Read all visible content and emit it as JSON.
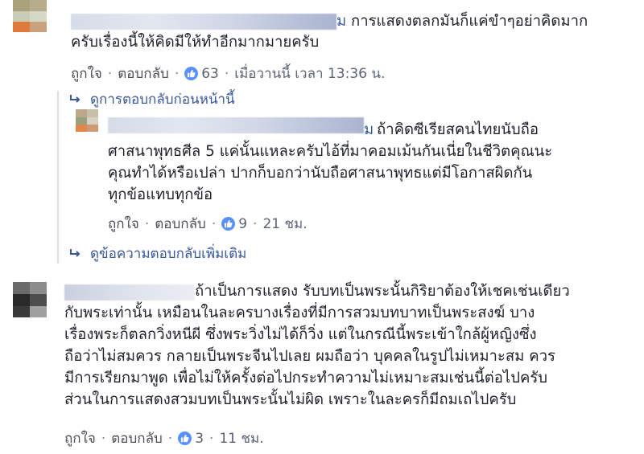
{
  "actions": {
    "like": "ถูกใจ",
    "reply": "ตอบกลับ",
    "dot": "·"
  },
  "comments": [
    {
      "name_visible": "ม",
      "lines": [
        "การแสดงตลกมันก็แค่ขำๆอย่าคิดมาก",
        "ครับเรื่องนี้ให้คิดมีให้ทำอีกมากมายครับ"
      ],
      "reactions": "63",
      "time": "เมื่อวานนี้ เวลา 13:36 น."
    },
    {
      "name_visible": "ม",
      "lines": [
        "ถ้าคิดซีเรียสคนไทยนับถือ",
        "ศาสนาพุทธศีล 5 แค่นั้นแหละครับไอ้ที่มาคอมเม้นกันเนี่ยในชีวิตคุณนะ",
        "คุณทำได้หรือเปล่า ปากก็บอกว่านับถือศาสนาพุทธแต่มีโอกาสผิดกัน",
        "ทุกข้อแทบทุกข้อ"
      ],
      "reactions": "9",
      "time": "21 ชม."
    },
    {
      "lines": [
        "ถ้าเป็นการแสดง รับบทเป็นพระนั้นกิริยาต้องให้เชคเช่นเดียว",
        "กับพระเท่านั้น เหมือนในละครบางเรื่องที่มีการสวมบทบาทเป็นพระสงฆ์ บาง",
        "เรื่องพระก็ตลกวิ่งหนีผี ซึ่งพระวิ่งไม่ได้ก็วิ่ง แต่ในกรณีนี้พระเข้าใกล้ผู้หญิงซึ่ง",
        "ถือว่าไม่สมควร กลายเป็นพระจีนไปเลย ผมถือว่า บุคคลในรูปไม่เหมาะสม ควร",
        "มีการเรียกมาพูด เพื่อไม่ให้ครั้งต่อไปกระทำความไม่เหมาะสมเช่นนี้ต่อไปครับ",
        "ส่วนในการแสดงสวมบทเป็นพระนั้นไม่ผิด เพราะในละครก็มีถมเถไปครับ"
      ],
      "reactions": "3",
      "time": "11 ชม."
    }
  ],
  "links": {
    "previous_replies": "ดูการตอบกลับก่อนหน้านี้",
    "more_replies": "ดูข้อความตอบกลับเพิ่มเติม"
  },
  "colors": {
    "link": "#385898",
    "like_badge": "#5890ff",
    "meta": "#5a6275",
    "text": "#1d2129"
  },
  "icons": {
    "reply_arrow": "reply-arrow-icon",
    "like": "thumbs-up-icon"
  }
}
